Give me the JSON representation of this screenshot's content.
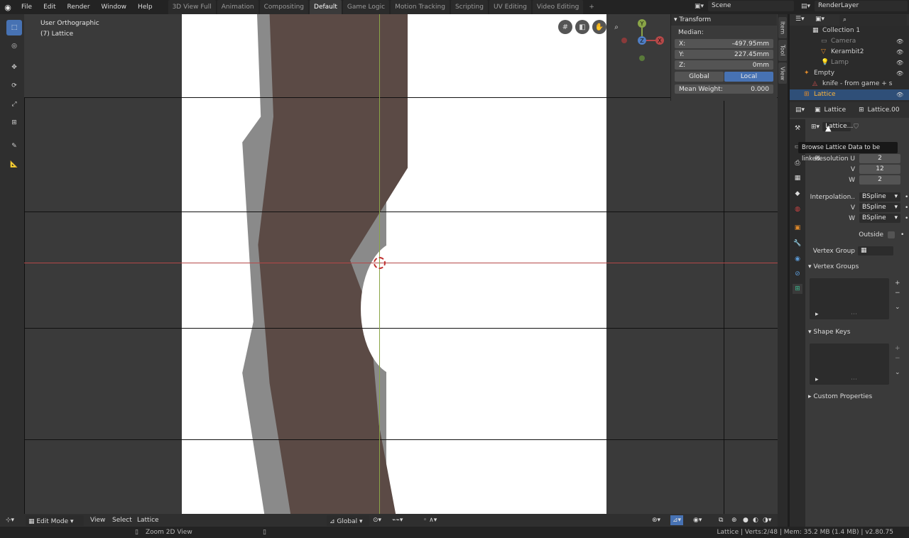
{
  "menu": [
    "File",
    "Edit",
    "Render",
    "Window",
    "Help"
  ],
  "workspace_tabs": [
    {
      "label": "3D View Full",
      "active": false
    },
    {
      "label": "Animation",
      "active": false
    },
    {
      "label": "Compositing",
      "active": false
    },
    {
      "label": "Default",
      "active": true
    },
    {
      "label": "Game Logic",
      "active": false
    },
    {
      "label": "Motion Tracking",
      "active": false
    },
    {
      "label": "Scripting",
      "active": false
    },
    {
      "label": "UV Editing",
      "active": false
    },
    {
      "label": "Video Editing",
      "active": false
    }
  ],
  "add_tab": "+",
  "scene": "Scene",
  "render_layer": "RenderLayer",
  "viewport": {
    "view_name": "User Orthographic",
    "object_name": "(7) Lattice"
  },
  "gizmo": {
    "y": "Y",
    "z": "Z",
    "x": "X"
  },
  "transform": {
    "title": "Transform",
    "median_label": "Median:",
    "x_label": "X:",
    "x_value": "-497.95mm",
    "y_label": "Y:",
    "y_value": "227.45mm",
    "z_label": "Z:",
    "z_value": "0mm",
    "global": "Global",
    "local": "Local",
    "mean_weight_label": "Mean Weight:",
    "mean_weight_value": "0.000"
  },
  "side_tabs": [
    "Item",
    "Tool",
    "View"
  ],
  "bottom": {
    "mode": "Edit Mode",
    "view": "View",
    "select": "Select",
    "lattice": "Lattice",
    "orientation": "Global"
  },
  "status": {
    "hint": "Zoom 2D View",
    "info": "Lattice | Verts:2/48 | Mem: 35.2 MB (1.4 MB) | v2.80.75"
  },
  "outliner": [
    {
      "label": "Collection 1",
      "indent": 2,
      "selected": false
    },
    {
      "label": "Camera",
      "indent": 3,
      "selected": false
    },
    {
      "label": "Kerambit2",
      "indent": 3,
      "selected": false
    },
    {
      "label": "Lamp",
      "indent": 3,
      "selected": false
    },
    {
      "label": "Empty",
      "indent": 1,
      "selected": false
    },
    {
      "label": "knife - from game + s",
      "indent": 2,
      "selected": false
    },
    {
      "label": "Lattice",
      "indent": 1,
      "selected": true
    }
  ],
  "props": {
    "object_name": "Lattice",
    "data_name": "Lattice.00",
    "datablock": "Lattice...",
    "tooltip": "Browse Lattice Data to be linked.",
    "resolution_u_label": "Resolution U",
    "resolution_u": "2",
    "v_label": "V",
    "resolution_v": "12",
    "w_label": "W",
    "resolution_w": "2",
    "interpolation_label": "Interpolation..",
    "interp_u": "BSpline",
    "interp_v": "BSpline",
    "interp_w": "BSpline",
    "outside_label": "Outside",
    "vertex_group_label": "Vertex Group",
    "vertex_groups_title": "Vertex Groups",
    "shape_keys_title": "Shape Keys",
    "custom_props_title": "Custom Properties"
  },
  "colors": {
    "accent": "#4772b3",
    "selected_row": "#2f4f78",
    "x_axis": "#b54848",
    "y_axis": "#8aa547"
  }
}
